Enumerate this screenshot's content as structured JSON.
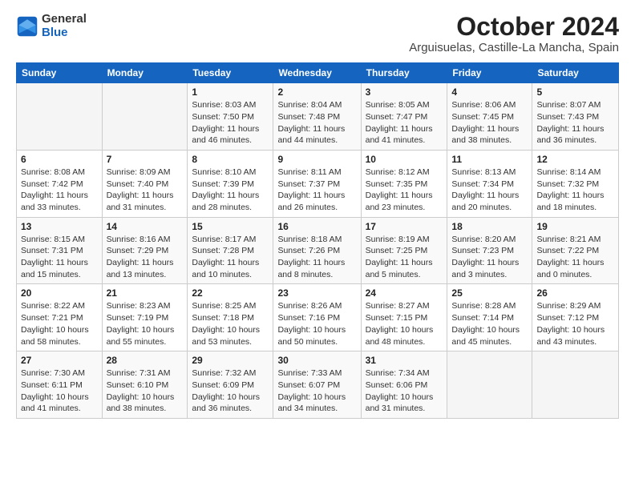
{
  "logo": {
    "line1": "General",
    "line2": "Blue"
  },
  "title": "October 2024",
  "subtitle": "Arguisuelas, Castille-La Mancha, Spain",
  "weekdays": [
    "Sunday",
    "Monday",
    "Tuesday",
    "Wednesday",
    "Thursday",
    "Friday",
    "Saturday"
  ],
  "weeks": [
    [
      {
        "day": "",
        "sunrise": "",
        "sunset": "",
        "daylight": ""
      },
      {
        "day": "",
        "sunrise": "",
        "sunset": "",
        "daylight": ""
      },
      {
        "day": "1",
        "sunrise": "Sunrise: 8:03 AM",
        "sunset": "Sunset: 7:50 PM",
        "daylight": "Daylight: 11 hours and 46 minutes."
      },
      {
        "day": "2",
        "sunrise": "Sunrise: 8:04 AM",
        "sunset": "Sunset: 7:48 PM",
        "daylight": "Daylight: 11 hours and 44 minutes."
      },
      {
        "day": "3",
        "sunrise": "Sunrise: 8:05 AM",
        "sunset": "Sunset: 7:47 PM",
        "daylight": "Daylight: 11 hours and 41 minutes."
      },
      {
        "day": "4",
        "sunrise": "Sunrise: 8:06 AM",
        "sunset": "Sunset: 7:45 PM",
        "daylight": "Daylight: 11 hours and 38 minutes."
      },
      {
        "day": "5",
        "sunrise": "Sunrise: 8:07 AM",
        "sunset": "Sunset: 7:43 PM",
        "daylight": "Daylight: 11 hours and 36 minutes."
      }
    ],
    [
      {
        "day": "6",
        "sunrise": "Sunrise: 8:08 AM",
        "sunset": "Sunset: 7:42 PM",
        "daylight": "Daylight: 11 hours and 33 minutes."
      },
      {
        "day": "7",
        "sunrise": "Sunrise: 8:09 AM",
        "sunset": "Sunset: 7:40 PM",
        "daylight": "Daylight: 11 hours and 31 minutes."
      },
      {
        "day": "8",
        "sunrise": "Sunrise: 8:10 AM",
        "sunset": "Sunset: 7:39 PM",
        "daylight": "Daylight: 11 hours and 28 minutes."
      },
      {
        "day": "9",
        "sunrise": "Sunrise: 8:11 AM",
        "sunset": "Sunset: 7:37 PM",
        "daylight": "Daylight: 11 hours and 26 minutes."
      },
      {
        "day": "10",
        "sunrise": "Sunrise: 8:12 AM",
        "sunset": "Sunset: 7:35 PM",
        "daylight": "Daylight: 11 hours and 23 minutes."
      },
      {
        "day": "11",
        "sunrise": "Sunrise: 8:13 AM",
        "sunset": "Sunset: 7:34 PM",
        "daylight": "Daylight: 11 hours and 20 minutes."
      },
      {
        "day": "12",
        "sunrise": "Sunrise: 8:14 AM",
        "sunset": "Sunset: 7:32 PM",
        "daylight": "Daylight: 11 hours and 18 minutes."
      }
    ],
    [
      {
        "day": "13",
        "sunrise": "Sunrise: 8:15 AM",
        "sunset": "Sunset: 7:31 PM",
        "daylight": "Daylight: 11 hours and 15 minutes."
      },
      {
        "day": "14",
        "sunrise": "Sunrise: 8:16 AM",
        "sunset": "Sunset: 7:29 PM",
        "daylight": "Daylight: 11 hours and 13 minutes."
      },
      {
        "day": "15",
        "sunrise": "Sunrise: 8:17 AM",
        "sunset": "Sunset: 7:28 PM",
        "daylight": "Daylight: 11 hours and 10 minutes."
      },
      {
        "day": "16",
        "sunrise": "Sunrise: 8:18 AM",
        "sunset": "Sunset: 7:26 PM",
        "daylight": "Daylight: 11 hours and 8 minutes."
      },
      {
        "day": "17",
        "sunrise": "Sunrise: 8:19 AM",
        "sunset": "Sunset: 7:25 PM",
        "daylight": "Daylight: 11 hours and 5 minutes."
      },
      {
        "day": "18",
        "sunrise": "Sunrise: 8:20 AM",
        "sunset": "Sunset: 7:23 PM",
        "daylight": "Daylight: 11 hours and 3 minutes."
      },
      {
        "day": "19",
        "sunrise": "Sunrise: 8:21 AM",
        "sunset": "Sunset: 7:22 PM",
        "daylight": "Daylight: 11 hours and 0 minutes."
      }
    ],
    [
      {
        "day": "20",
        "sunrise": "Sunrise: 8:22 AM",
        "sunset": "Sunset: 7:21 PM",
        "daylight": "Daylight: 10 hours and 58 minutes."
      },
      {
        "day": "21",
        "sunrise": "Sunrise: 8:23 AM",
        "sunset": "Sunset: 7:19 PM",
        "daylight": "Daylight: 10 hours and 55 minutes."
      },
      {
        "day": "22",
        "sunrise": "Sunrise: 8:25 AM",
        "sunset": "Sunset: 7:18 PM",
        "daylight": "Daylight: 10 hours and 53 minutes."
      },
      {
        "day": "23",
        "sunrise": "Sunrise: 8:26 AM",
        "sunset": "Sunset: 7:16 PM",
        "daylight": "Daylight: 10 hours and 50 minutes."
      },
      {
        "day": "24",
        "sunrise": "Sunrise: 8:27 AM",
        "sunset": "Sunset: 7:15 PM",
        "daylight": "Daylight: 10 hours and 48 minutes."
      },
      {
        "day": "25",
        "sunrise": "Sunrise: 8:28 AM",
        "sunset": "Sunset: 7:14 PM",
        "daylight": "Daylight: 10 hours and 45 minutes."
      },
      {
        "day": "26",
        "sunrise": "Sunrise: 8:29 AM",
        "sunset": "Sunset: 7:12 PM",
        "daylight": "Daylight: 10 hours and 43 minutes."
      }
    ],
    [
      {
        "day": "27",
        "sunrise": "Sunrise: 7:30 AM",
        "sunset": "Sunset: 6:11 PM",
        "daylight": "Daylight: 10 hours and 41 minutes."
      },
      {
        "day": "28",
        "sunrise": "Sunrise: 7:31 AM",
        "sunset": "Sunset: 6:10 PM",
        "daylight": "Daylight: 10 hours and 38 minutes."
      },
      {
        "day": "29",
        "sunrise": "Sunrise: 7:32 AM",
        "sunset": "Sunset: 6:09 PM",
        "daylight": "Daylight: 10 hours and 36 minutes."
      },
      {
        "day": "30",
        "sunrise": "Sunrise: 7:33 AM",
        "sunset": "Sunset: 6:07 PM",
        "daylight": "Daylight: 10 hours and 34 minutes."
      },
      {
        "day": "31",
        "sunrise": "Sunrise: 7:34 AM",
        "sunset": "Sunset: 6:06 PM",
        "daylight": "Daylight: 10 hours and 31 minutes."
      },
      {
        "day": "",
        "sunrise": "",
        "sunset": "",
        "daylight": ""
      },
      {
        "day": "",
        "sunrise": "",
        "sunset": "",
        "daylight": ""
      }
    ]
  ]
}
